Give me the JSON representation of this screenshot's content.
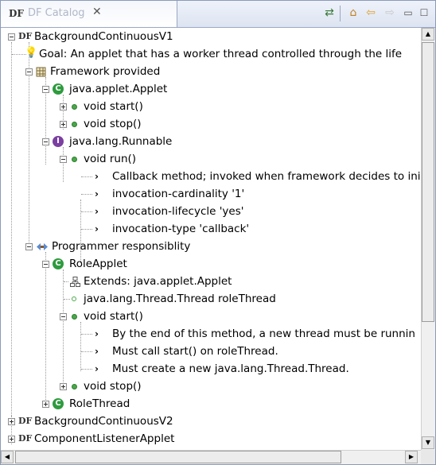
{
  "tab": {
    "icon_text": "DF",
    "title": "DF Catalog",
    "close": "✕"
  },
  "toolbar": {
    "sync": "⇄",
    "home": "⌂",
    "back": "⇦",
    "forward": "⇨",
    "minimize": "▭",
    "maximize": "☐"
  },
  "tree": {
    "root1": "BackgroundContinuousV1",
    "goal": "Goal: An applet that has a worker thread controlled through the life",
    "framework": "Framework provided",
    "applet": "java.applet.Applet",
    "start": "void start()",
    "stop": "void stop()",
    "runnable": "java.lang.Runnable",
    "run": "void run()",
    "callback": "Callback method; invoked when framework decides to init",
    "cardinality": "invocation-cardinality '1'",
    "lifecycle": "invocation-lifecycle 'yes'",
    "type": "invocation-type 'callback'",
    "programmer": "Programmer responsiblity",
    "roleapplet": "RoleApplet",
    "extends": "Extends: java.applet.Applet",
    "field": "java.lang.Thread.Thread roleThread",
    "start2": "void start()",
    "note1": "By the end of this method, a new thread must be runnin",
    "note2": "Must call start() on roleThread.",
    "note3": "Must create a new java.lang.Thread.Thread.",
    "stop2": "void stop()",
    "rolethread": "RoleThread",
    "root2": "BackgroundContinuousV2",
    "root3": "ComponentListenerApplet"
  },
  "icons": {
    "df": "DF",
    "class_letter": "C",
    "interface_letter": "I",
    "arrow": "›",
    "bulb": "💡"
  },
  "colors": {
    "class_icon": "#2e9b3e",
    "interface_icon": "#7a3fa0",
    "method_dot": "#4aa84a"
  }
}
